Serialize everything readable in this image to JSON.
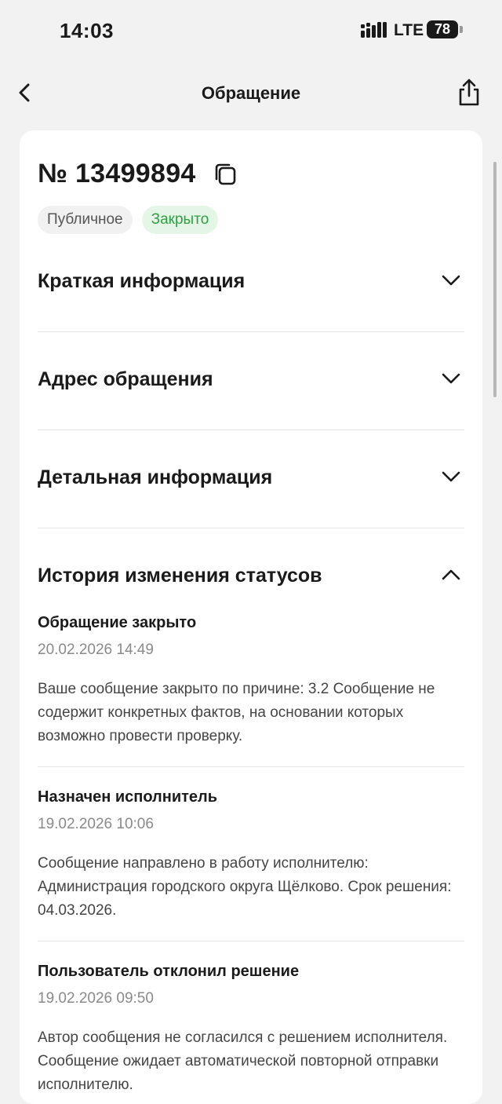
{
  "status_bar": {
    "time": "14:03",
    "network": "LTE",
    "battery": "78"
  },
  "nav": {
    "title": "Обращение",
    "back_icon": "chevron-left-icon",
    "share_icon": "share-icon"
  },
  "request": {
    "number": "№ 13499894",
    "badges": {
      "visibility": "Публичное",
      "status": "Закрыто"
    },
    "status_color": "#2ea043"
  },
  "sections": {
    "brief": "Краткая информация",
    "address": "Адрес обращения",
    "details": "Детальная информация",
    "history": "История изменения статусов"
  },
  "history": [
    {
      "title": "Обращение закрыто",
      "date": "20.02.2026 14:49",
      "text": "Ваше сообщение закрыто по причине: 3.2 Сообщение не содержит конкретных фактов, на основании которых возможно провести проверку."
    },
    {
      "title": "Назначен исполнитель",
      "date": "19.02.2026 10:06",
      "text": "Сообщение направлено в работу исполнителю: Администрация городского округа Щёлково. Срок решения: 04.03.2026."
    },
    {
      "title": "Пользователь отклонил решение",
      "date": "19.02.2026 09:50",
      "text": "Автор сообщения не согласился с решением исполнителя. Сообщение ожидает автоматической повторной отправки исполнителю."
    }
  ]
}
